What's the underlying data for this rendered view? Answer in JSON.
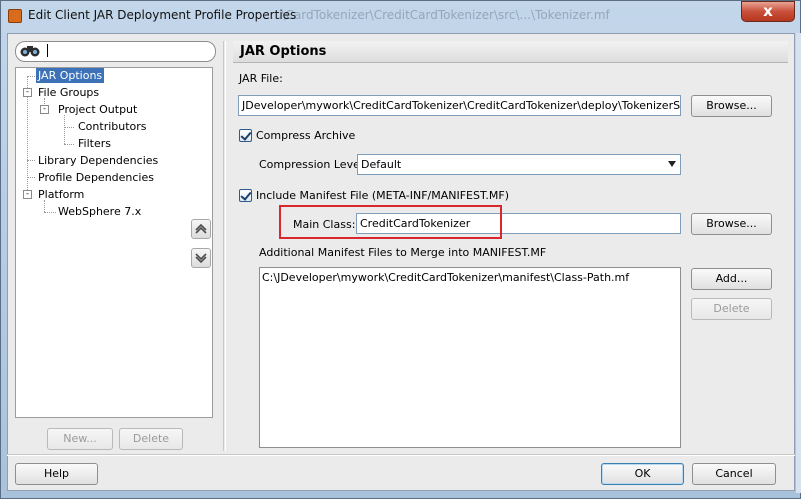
{
  "window": {
    "title": "Edit Client JAR Deployment Profile Properties",
    "background_title": "...\\CardTokenizer\\CreditCardTokenizer\\src\\...\\Tokenizer.mf",
    "close_glyph": "x"
  },
  "search": {
    "value": "",
    "icon": "binoculars-icon"
  },
  "tree": {
    "items": [
      {
        "label": "JAR Options",
        "selected": true
      },
      {
        "label": "File Groups",
        "expander": "-"
      },
      {
        "label": "Project Output",
        "expander": "-"
      },
      {
        "label": "Contributors"
      },
      {
        "label": "Filters"
      },
      {
        "label": "Library Dependencies"
      },
      {
        "label": "Profile Dependencies"
      },
      {
        "label": "Platform",
        "expander": "-"
      },
      {
        "label": "WebSphere 7.x"
      }
    ],
    "new_button": "New...",
    "delete_button": "Delete"
  },
  "section": {
    "title": "JAR Options",
    "jar_file_label": "JAR File:",
    "jar_file_value": "JDeveloper\\mywork\\CreditCardTokenizer\\CreditCardTokenizer\\deploy\\TokenizerService.jar",
    "browse_label": "Browse...",
    "compress_label": "Compress Archive",
    "compress_checked": true,
    "compression_level_label": "Compression Level",
    "compression_level_value": "Default",
    "include_manifest_label": "Include Manifest File (META-INF/MANIFEST.MF)",
    "include_manifest_checked": true,
    "main_class_label": "Main Class:",
    "main_class_value": "CreditCardTokenizer",
    "main_class_browse": "Browse...",
    "additional_label": "Additional Manifest Files to Merge into MANIFEST.MF",
    "manifest_files": [
      "C:\\JDeveloper\\mywork\\CreditCardTokenizer\\manifest\\Class-Path.mf"
    ],
    "add_button": "Add...",
    "delete_button": "Delete"
  },
  "footer": {
    "help_button": "Help",
    "ok_button": "OK",
    "cancel_button": "Cancel"
  },
  "colors": {
    "selection": "#3d72b8",
    "highlight_box": "#d8272d",
    "title_gradient_top": "#c3d6ea"
  }
}
